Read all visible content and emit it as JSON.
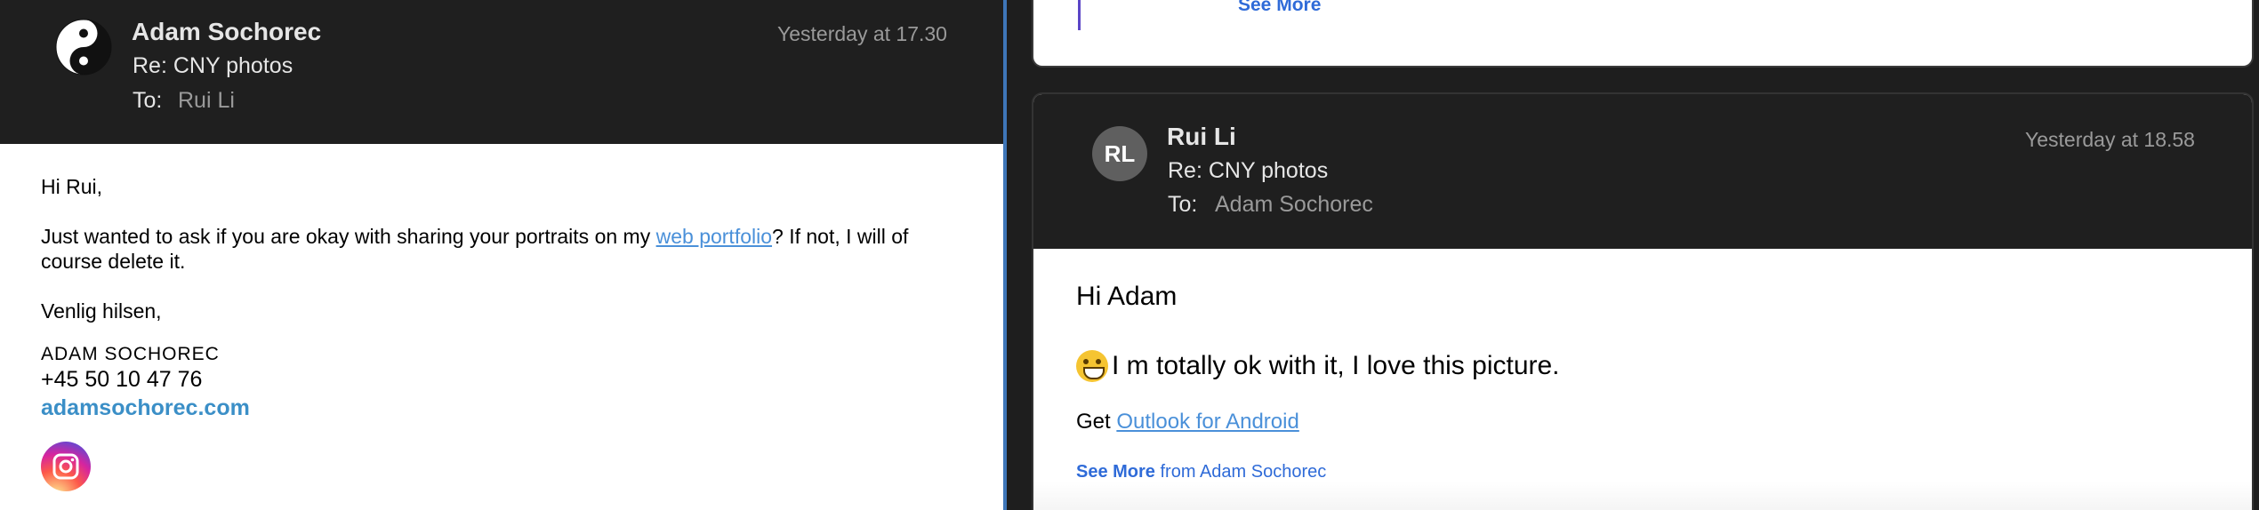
{
  "left_email": {
    "sender": "Adam Sochorec",
    "subject": "Re: CNY photos",
    "to_label": "To:",
    "to_value": "Rui Li",
    "timestamp": "Yesterday at 17.30",
    "body": {
      "greeting": "Hi Rui,",
      "line1_pre": "Just wanted to ask if you are okay with sharing your portraits on my ",
      "link_text": "web portfolio",
      "line1_post": "? If not, I will of course delete it.",
      "signoff": "Venlig hilsen,",
      "sig_name": "ADAM SOCHOREC",
      "sig_phone": "+45 50 10 47 76",
      "sig_web": "adamsochorec.com"
    }
  },
  "previous_email": {
    "see_more": "See More"
  },
  "right_email": {
    "avatar_initials": "RL",
    "sender": "Rui Li",
    "subject": "Re: CNY photos",
    "to_label": "To:",
    "to_value": "Adam Sochorec",
    "timestamp": "Yesterday at 18.58",
    "body": {
      "greeting": "Hi Adam",
      "line": "I m totally ok with it, I love this picture.",
      "get_prefix": "Get ",
      "get_link": "Outlook for Android",
      "see_more": "See More",
      "see_more_suffix": " from Adam Sochorec"
    }
  },
  "icons": {
    "avatar_left": "yin-yang-icon",
    "instagram": "instagram-icon",
    "emoji": "grinning-face-icon"
  },
  "colors": {
    "header_bg": "#1f1f1f",
    "accent_blue": "#3e76b8",
    "link_blue": "#4a90d9",
    "see_more_blue": "#2f6bd8"
  }
}
